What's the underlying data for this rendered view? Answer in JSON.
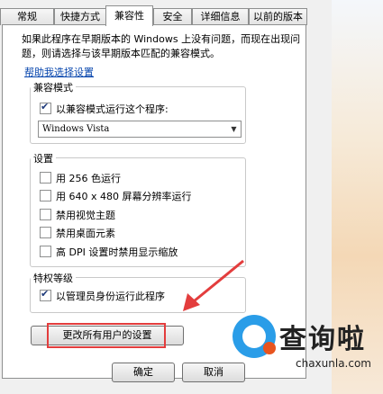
{
  "tabs": [
    "常规",
    "快捷方式",
    "兼容性",
    "安全",
    "详细信息",
    "以前的版本"
  ],
  "intro_text": "如果此程序在早期版本的 Windows 上没有问题，而现在出现问题，则请选择与该早期版本匹配的兼容模式。",
  "help_link": "帮助我选择设置",
  "compat": {
    "label": "兼容模式",
    "checkbox_label": "以兼容模式运行这个程序:",
    "checked": true,
    "selected_os": "Windows Vista"
  },
  "settings": {
    "label": "设置",
    "items": [
      {
        "label": "用 256 色运行",
        "checked": false
      },
      {
        "label": "用 640 x 480 屏幕分辨率运行",
        "checked": false
      },
      {
        "label": "禁用视觉主题",
        "checked": false
      },
      {
        "label": "禁用桌面元素",
        "checked": false
      },
      {
        "label": "高 DPI 设置时禁用显示缩放",
        "checked": false
      }
    ]
  },
  "privilege": {
    "label": "特权等级",
    "checkbox_label": "以管理员身份运行此程序",
    "checked": true
  },
  "change_all_button": "更改所有用户的设置",
  "ok_button": "确定",
  "cancel_button": "取消",
  "watermark": {
    "name": "查询啦",
    "url": "chaxunla.com"
  },
  "colors": {
    "highlight": "#e33d3d",
    "arrow": "#e33d3d",
    "link": "#0645ad"
  }
}
